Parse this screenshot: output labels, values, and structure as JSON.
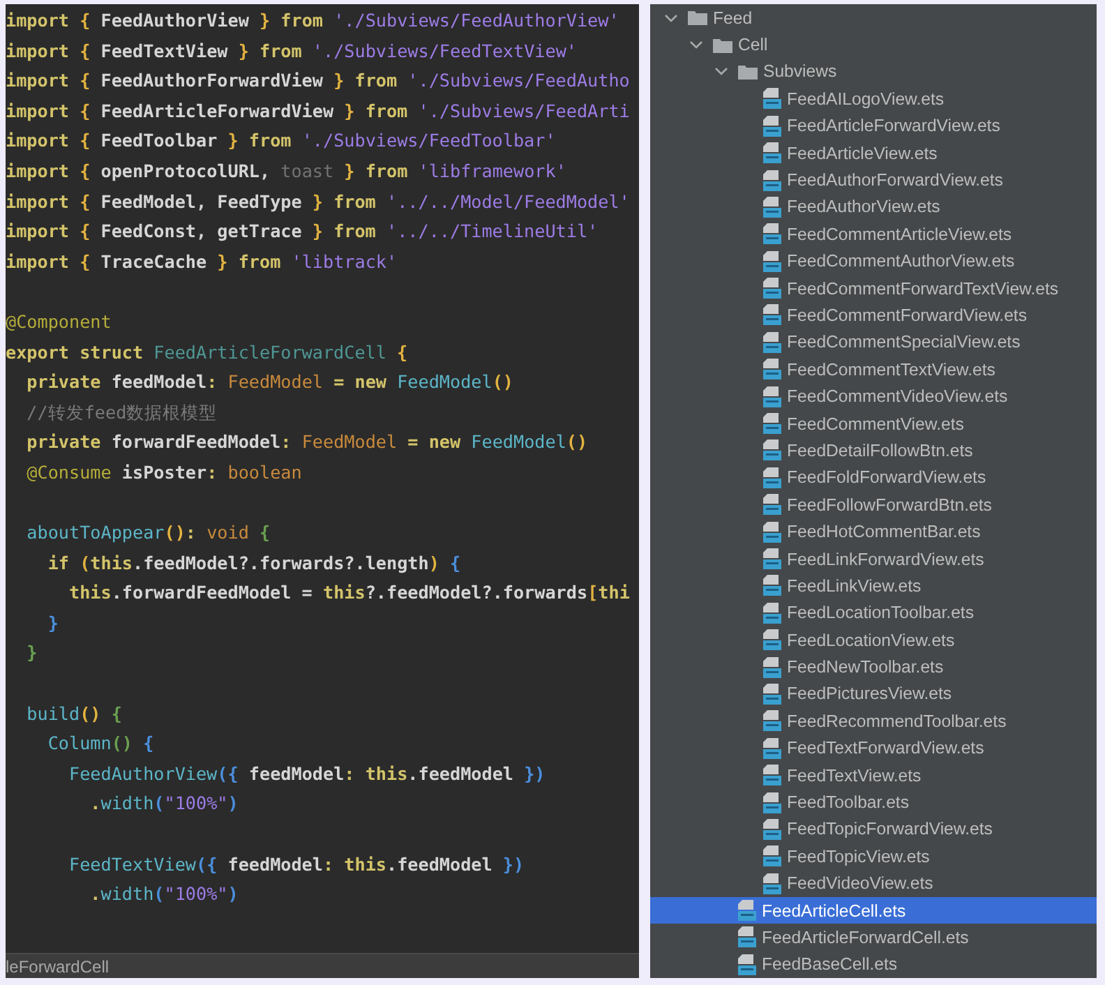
{
  "editor": {
    "lines": [
      {
        "kind": "code",
        "tokens": [
          {
            "text": "import",
            "kind": "kw"
          },
          {
            "text": " { ",
            "kind": "brace"
          },
          {
            "text": "FeedAuthorView",
            "kind": "ident"
          },
          {
            "text": " } ",
            "kind": "brace"
          },
          {
            "text": "from",
            "kind": "kw"
          },
          {
            "text": " './Subviews/FeedAuthorView'",
            "kind": "str"
          }
        ]
      },
      {
        "kind": "code",
        "tokens": [
          {
            "text": "import",
            "kind": "kw"
          },
          {
            "text": " { ",
            "kind": "brace"
          },
          {
            "text": "FeedTextView",
            "kind": "ident"
          },
          {
            "text": " } ",
            "kind": "brace"
          },
          {
            "text": "from",
            "kind": "kw"
          },
          {
            "text": " './Subviews/FeedTextView'",
            "kind": "str"
          }
        ]
      },
      {
        "kind": "code",
        "tokens": [
          {
            "text": "import",
            "kind": "kw"
          },
          {
            "text": " { ",
            "kind": "brace"
          },
          {
            "text": "FeedAuthorForwardView",
            "kind": "ident"
          },
          {
            "text": " } ",
            "kind": "brace"
          },
          {
            "text": "from",
            "kind": "kw"
          },
          {
            "text": " './Subviews/FeedAutho",
            "kind": "str"
          }
        ]
      },
      {
        "kind": "code",
        "tokens": [
          {
            "text": "import",
            "kind": "kw"
          },
          {
            "text": " { ",
            "kind": "brace"
          },
          {
            "text": "FeedArticleForwardView",
            "kind": "ident"
          },
          {
            "text": " } ",
            "kind": "brace"
          },
          {
            "text": "from",
            "kind": "kw"
          },
          {
            "text": " './Subviews/FeedArti",
            "kind": "str"
          }
        ]
      },
      {
        "kind": "code",
        "tokens": [
          {
            "text": "import",
            "kind": "kw"
          },
          {
            "text": " { ",
            "kind": "brace"
          },
          {
            "text": "FeedToolbar",
            "kind": "ident"
          },
          {
            "text": " } ",
            "kind": "brace"
          },
          {
            "text": "from",
            "kind": "kw"
          },
          {
            "text": " './Subviews/FeedToolbar'",
            "kind": "str"
          }
        ]
      },
      {
        "kind": "code",
        "tokens": [
          {
            "text": "import",
            "kind": "kw"
          },
          {
            "text": " { ",
            "kind": "brace"
          },
          {
            "text": "openProtocolURL, ",
            "kind": "ident"
          },
          {
            "text": "toast",
            "kind": "dim"
          },
          {
            "text": " } ",
            "kind": "brace"
          },
          {
            "text": "from",
            "kind": "kw"
          },
          {
            "text": " 'libframework'",
            "kind": "str"
          }
        ]
      },
      {
        "kind": "code",
        "tokens": [
          {
            "text": "import",
            "kind": "kw"
          },
          {
            "text": " { ",
            "kind": "brace"
          },
          {
            "text": "FeedModel, FeedType",
            "kind": "ident"
          },
          {
            "text": " } ",
            "kind": "brace"
          },
          {
            "text": "from",
            "kind": "kw"
          },
          {
            "text": " '../../Model/FeedModel'",
            "kind": "str"
          }
        ]
      },
      {
        "kind": "code",
        "tokens": [
          {
            "text": "import",
            "kind": "kw"
          },
          {
            "text": " { ",
            "kind": "brace"
          },
          {
            "text": "FeedConst, getTrace",
            "kind": "ident"
          },
          {
            "text": " } ",
            "kind": "brace"
          },
          {
            "text": "from",
            "kind": "kw"
          },
          {
            "text": " '../../TimelineUtil'",
            "kind": "str"
          }
        ]
      },
      {
        "kind": "code",
        "tokens": [
          {
            "text": "import",
            "kind": "kw"
          },
          {
            "text": " { ",
            "kind": "brace"
          },
          {
            "text": "TraceCache",
            "kind": "ident"
          },
          {
            "text": " } ",
            "kind": "brace"
          },
          {
            "text": "from",
            "kind": "kw"
          },
          {
            "text": " 'libtrack'",
            "kind": "str"
          }
        ]
      },
      {
        "kind": "blank"
      },
      {
        "kind": "code",
        "tokens": [
          {
            "text": "@Component",
            "kind": "anno"
          }
        ]
      },
      {
        "kind": "code",
        "tokens": [
          {
            "text": "export struct ",
            "kind": "kw"
          },
          {
            "text": "FeedArticleForwardCell",
            "kind": "sname"
          },
          {
            "text": " {",
            "kind": "brace"
          }
        ]
      },
      {
        "kind": "code",
        "tokens": [
          {
            "text": "  private ",
            "kind": "kw"
          },
          {
            "text": "feedModel",
            "kind": "ident"
          },
          {
            "text": ": ",
            "kind": "kw"
          },
          {
            "text": "FeedModel",
            "kind": "type"
          },
          {
            "text": " = new ",
            "kind": "kw"
          },
          {
            "text": "FeedModel",
            "kind": "call"
          },
          {
            "text": "()",
            "kind": "brace"
          }
        ]
      },
      {
        "kind": "code",
        "tokens": [
          {
            "text": "  //转发feed数据根模型",
            "kind": "cmt"
          }
        ]
      },
      {
        "kind": "code",
        "tokens": [
          {
            "text": "  private ",
            "kind": "kw"
          },
          {
            "text": "forwardFeedModel",
            "kind": "ident"
          },
          {
            "text": ": ",
            "kind": "kw"
          },
          {
            "text": "FeedModel",
            "kind": "type"
          },
          {
            "text": " = new ",
            "kind": "kw"
          },
          {
            "text": "FeedModel",
            "kind": "call"
          },
          {
            "text": "()",
            "kind": "brace"
          }
        ]
      },
      {
        "kind": "code",
        "tokens": [
          {
            "text": "  @Consume ",
            "kind": "anno"
          },
          {
            "text": "isPoster",
            "kind": "ident"
          },
          {
            "text": ": ",
            "kind": "kw"
          },
          {
            "text": "boolean",
            "kind": "type"
          }
        ]
      },
      {
        "kind": "blank"
      },
      {
        "kind": "code",
        "tokens": [
          {
            "text": "  aboutToAppear",
            "kind": "call"
          },
          {
            "text": "()",
            "kind": "brace"
          },
          {
            "text": ": ",
            "kind": "kw"
          },
          {
            "text": "void",
            "kind": "type"
          },
          {
            "text": " {",
            "kind": "green"
          }
        ]
      },
      {
        "kind": "code",
        "tokens": [
          {
            "text": "    if ",
            "kind": "kw"
          },
          {
            "text": "(",
            "kind": "brace"
          },
          {
            "text": "this",
            "kind": "kw"
          },
          {
            "text": ".feedModel?.forwards?.length",
            "kind": "ident"
          },
          {
            "text": ")",
            "kind": "brace"
          },
          {
            "text": " {",
            "kind": "blue"
          }
        ]
      },
      {
        "kind": "code",
        "tokens": [
          {
            "text": "      this",
            "kind": "kw"
          },
          {
            "text": ".forwardFeedModel = ",
            "kind": "ident"
          },
          {
            "text": "this",
            "kind": "kw"
          },
          {
            "text": "?.feedModel?.forwards",
            "kind": "ident"
          },
          {
            "text": "[",
            "kind": "brace"
          },
          {
            "text": "thi",
            "kind": "kw"
          }
        ]
      },
      {
        "kind": "code",
        "tokens": [
          {
            "text": "    }",
            "kind": "blue"
          }
        ]
      },
      {
        "kind": "code",
        "tokens": [
          {
            "text": "  }",
            "kind": "green"
          }
        ]
      },
      {
        "kind": "blank"
      },
      {
        "kind": "code",
        "tokens": [
          {
            "text": "  build",
            "kind": "call"
          },
          {
            "text": "()",
            "kind": "brace"
          },
          {
            "text": " {",
            "kind": "green"
          }
        ]
      },
      {
        "kind": "code",
        "tokens": [
          {
            "text": "    Column",
            "kind": "call"
          },
          {
            "text": "()",
            "kind": "green"
          },
          {
            "text": " {",
            "kind": "blue"
          }
        ]
      },
      {
        "kind": "code",
        "tokens": [
          {
            "text": "      FeedAuthorView",
            "kind": "call"
          },
          {
            "text": "({ ",
            "kind": "blue"
          },
          {
            "text": "feedModel",
            "kind": "ident"
          },
          {
            "text": ": ",
            "kind": "kw"
          },
          {
            "text": "this",
            "kind": "kw"
          },
          {
            "text": ".feedModel",
            "kind": "ident"
          },
          {
            "text": " })",
            "kind": "blue"
          }
        ]
      },
      {
        "kind": "code",
        "tokens": [
          {
            "text": "        .",
            "kind": "kw"
          },
          {
            "text": "width",
            "kind": "call"
          },
          {
            "text": "(",
            "kind": "blue"
          },
          {
            "text": "\"100%\"",
            "kind": "str"
          },
          {
            "text": ")",
            "kind": "blue"
          }
        ]
      },
      {
        "kind": "blank"
      },
      {
        "kind": "code",
        "tokens": [
          {
            "text": "      FeedTextView",
            "kind": "call"
          },
          {
            "text": "({ ",
            "kind": "blue"
          },
          {
            "text": "feedModel",
            "kind": "ident"
          },
          {
            "text": ": ",
            "kind": "kw"
          },
          {
            "text": "this",
            "kind": "kw"
          },
          {
            "text": ".feedModel",
            "kind": "ident"
          },
          {
            "text": " })",
            "kind": "blue"
          }
        ]
      },
      {
        "kind": "code",
        "tokens": [
          {
            "text": "        .",
            "kind": "kw"
          },
          {
            "text": "width",
            "kind": "call"
          },
          {
            "text": "(",
            "kind": "blue"
          },
          {
            "text": "\"100%\"",
            "kind": "str"
          },
          {
            "text": ")",
            "kind": "blue"
          }
        ]
      }
    ],
    "status_text": "leForwardCell"
  },
  "project_tree": {
    "items": [
      {
        "label": "Feed",
        "kind": "folder",
        "expanded": true,
        "selected": false,
        "children": [
          {
            "label": "Cell",
            "kind": "folder",
            "expanded": true,
            "selected": false,
            "children": [
              {
                "label": "Subviews",
                "kind": "folder",
                "expanded": true,
                "selected": false,
                "children": [
                  {
                    "label": "FeedAILogoView.ets",
                    "kind": "file",
                    "selected": false
                  },
                  {
                    "label": "FeedArticleForwardView.ets",
                    "kind": "file",
                    "selected": false
                  },
                  {
                    "label": "FeedArticleView.ets",
                    "kind": "file",
                    "selected": false
                  },
                  {
                    "label": "FeedAuthorForwardView.ets",
                    "kind": "file",
                    "selected": false
                  },
                  {
                    "label": "FeedAuthorView.ets",
                    "kind": "file",
                    "selected": false
                  },
                  {
                    "label": "FeedCommentArticleView.ets",
                    "kind": "file",
                    "selected": false
                  },
                  {
                    "label": "FeedCommentAuthorView.ets",
                    "kind": "file",
                    "selected": false
                  },
                  {
                    "label": "FeedCommentForwardTextView.ets",
                    "kind": "file",
                    "selected": false
                  },
                  {
                    "label": "FeedCommentForwardView.ets",
                    "kind": "file",
                    "selected": false
                  },
                  {
                    "label": "FeedCommentSpecialView.ets",
                    "kind": "file",
                    "selected": false
                  },
                  {
                    "label": "FeedCommentTextView.ets",
                    "kind": "file",
                    "selected": false
                  },
                  {
                    "label": "FeedCommentVideoView.ets",
                    "kind": "file",
                    "selected": false
                  },
                  {
                    "label": "FeedCommentView.ets",
                    "kind": "file",
                    "selected": false
                  },
                  {
                    "label": "FeedDetailFollowBtn.ets",
                    "kind": "file",
                    "selected": false
                  },
                  {
                    "label": "FeedFoldForwardView.ets",
                    "kind": "file",
                    "selected": false
                  },
                  {
                    "label": "FeedFollowForwardBtn.ets",
                    "kind": "file",
                    "selected": false
                  },
                  {
                    "label": "FeedHotCommentBar.ets",
                    "kind": "file",
                    "selected": false
                  },
                  {
                    "label": "FeedLinkForwardView.ets",
                    "kind": "file",
                    "selected": false
                  },
                  {
                    "label": "FeedLinkView.ets",
                    "kind": "file",
                    "selected": false
                  },
                  {
                    "label": "FeedLocationToolbar.ets",
                    "kind": "file",
                    "selected": false
                  },
                  {
                    "label": "FeedLocationView.ets",
                    "kind": "file",
                    "selected": false
                  },
                  {
                    "label": "FeedNewToolbar.ets",
                    "kind": "file",
                    "selected": false
                  },
                  {
                    "label": "FeedPicturesView.ets",
                    "kind": "file",
                    "selected": false
                  },
                  {
                    "label": "FeedRecommendToolbar.ets",
                    "kind": "file",
                    "selected": false
                  },
                  {
                    "label": "FeedTextForwardView.ets",
                    "kind": "file",
                    "selected": false
                  },
                  {
                    "label": "FeedTextView.ets",
                    "kind": "file",
                    "selected": false
                  },
                  {
                    "label": "FeedToolbar.ets",
                    "kind": "file",
                    "selected": false
                  },
                  {
                    "label": "FeedTopicForwardView.ets",
                    "kind": "file",
                    "selected": false
                  },
                  {
                    "label": "FeedTopicView.ets",
                    "kind": "file",
                    "selected": false
                  },
                  {
                    "label": "FeedVideoView.ets",
                    "kind": "file",
                    "selected": false
                  }
                ]
              },
              {
                "label": "FeedArticleCell.ets",
                "kind": "file",
                "selected": true
              },
              {
                "label": "FeedArticleForwardCell.ets",
                "kind": "file",
                "selected": false
              },
              {
                "label": "FeedBaseCell.ets",
                "kind": "file",
                "selected": false
              }
            ]
          }
        ]
      }
    ]
  }
}
